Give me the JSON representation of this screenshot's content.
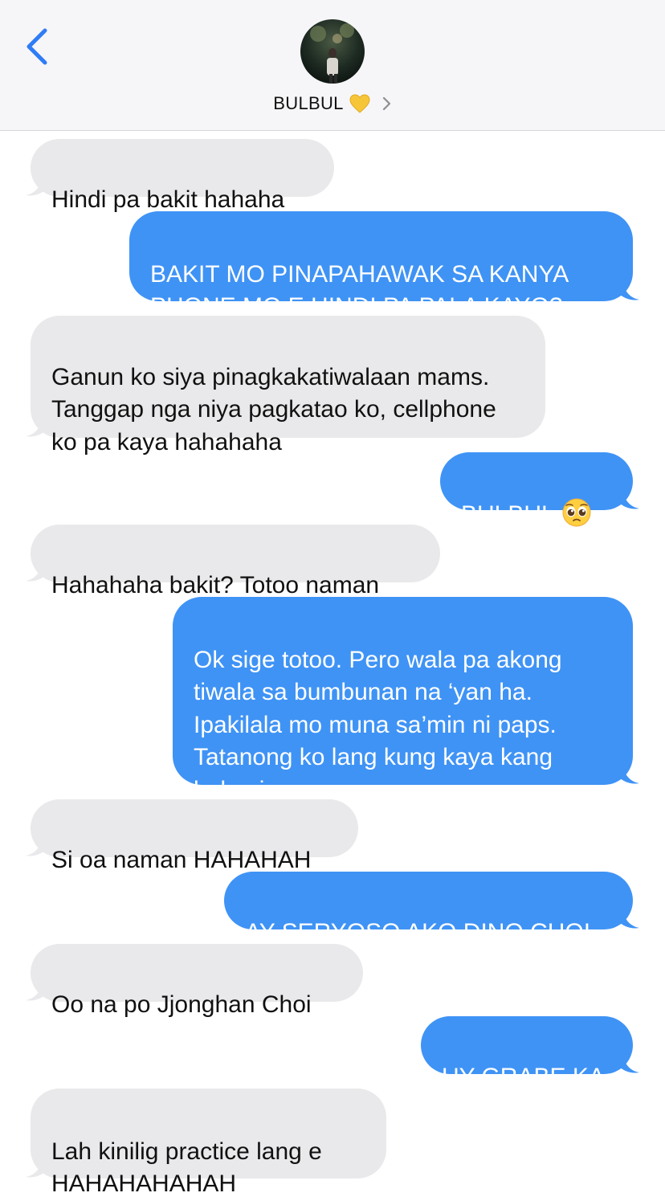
{
  "header": {
    "contact_name": "BULBUL",
    "icons": {
      "back": "chevron-left-icon",
      "heart": "yellow-heart-icon",
      "details": "chevron-right-icon"
    }
  },
  "colors": {
    "incoming_bubble": "#e9e9eb",
    "outgoing_bubble": "#3f93f5",
    "accent": "#2f7cf6"
  },
  "messages": [
    {
      "direction": "in",
      "text": "Hindi pa bakit hahaha"
    },
    {
      "direction": "out",
      "text": "BAKIT MO PINAPAHAWAK SA KANYA PHONE MO E HINDI PA PALA KAYO?"
    },
    {
      "direction": "in",
      "text": "Ganun ko siya pinagkakatiwalaan mams. Tanggap nga niya pagkatao ko, cellphone ko pa kaya hahahaha"
    },
    {
      "direction": "out",
      "text": "BULBUL",
      "emoji": "pleading-face-icon"
    },
    {
      "direction": "in",
      "text": "Hahahaha bakit? Totoo naman"
    },
    {
      "direction": "out",
      "text": "Ok sige totoo. Pero wala pa akong tiwala sa bumbunan na ‘yan ha. Ipakilala mo muna sa’min ni paps. Tatanong ko lang kung kaya kang buhayin."
    },
    {
      "direction": "in",
      "text": "Si oa naman HAHAHAH"
    },
    {
      "direction": "out",
      "text": "AY SERYOSO AKO DINO CHOI"
    },
    {
      "direction": "in",
      "text": "Oo na po Jjonghan Choi"
    },
    {
      "direction": "out",
      "text": "UY GRABE KA"
    },
    {
      "direction": "in",
      "text": "Lah kinilig practice lang e HAHAHAHAHAH"
    }
  ]
}
